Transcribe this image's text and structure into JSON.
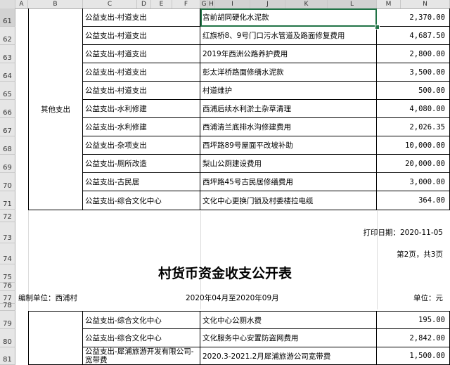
{
  "columns": [
    "A",
    "B",
    "C",
    "D",
    "E",
    "F",
    "G",
    "H",
    "I",
    "J",
    "K",
    "L",
    "M",
    "N"
  ],
  "selected_cell": "G61",
  "rows_top": [
    {
      "row": "61",
      "category": "公益支出-村道支出",
      "desc": "宫前胡同硬化水泥款",
      "amount": "2,370.00"
    },
    {
      "row": "62",
      "category": "公益支出-村道支出",
      "desc": "红旗桥8、9号门口污水管道及路面修复费用",
      "amount": "4,687.50"
    },
    {
      "row": "63",
      "category": "公益支出-村道支出",
      "desc": "2019年西洲公路养护费用",
      "amount": "2,800.00"
    },
    {
      "row": "64",
      "category": "公益支出-村道支出",
      "desc": "彭太洋桥路面修缮水泥款",
      "amount": "3,500.00"
    },
    {
      "row": "65",
      "category": "公益支出-村道支出",
      "desc": "村道维护",
      "amount": "500.00"
    },
    {
      "row": "66",
      "category": "公益支出-水利修建",
      "desc": "西浦后续水利淤土杂草清理",
      "amount": "4,080.00"
    },
    {
      "row": "67",
      "category": "公益支出-水利修建",
      "desc": "西浦清兰底排水沟修建费用",
      "amount": "2,026.35"
    },
    {
      "row": "68",
      "category": "公益支出-杂项支出",
      "desc": "西坪路89号屋面平改坡补助",
      "amount": "10,000.00"
    },
    {
      "row": "69",
      "category": "公益支出-厕所改造",
      "desc": "梨山公厕建设费用",
      "amount": "20,000.00"
    },
    {
      "row": "70",
      "category": "公益支出-古民居",
      "desc": "西坪路45号古民居修缮费用",
      "amount": "3,000.00"
    },
    {
      "row": "71",
      "category": "公益支出-综合文化中心",
      "desc": "文化中心更换门锁及村委楼拉电缆",
      "amount": "364.00"
    }
  ],
  "group_label": "其他支出",
  "print_date": "打印日期：2020-11-05",
  "page_info": "第2页，共3页",
  "title": "村货币资金收支公开表",
  "unit_org": "编制单位：西浦村",
  "period": "2020年04月至2020年09月",
  "unit": "单位：元",
  "rows_bottom": [
    {
      "row": "79",
      "category": "公益支出-综合文化中心",
      "desc": "文化中心公厕水费",
      "amount": "195.00"
    },
    {
      "row": "80",
      "category": "公益支出-综合文化中心",
      "desc": "文化服务中心安置防盗网费用",
      "amount": "2,842.00"
    },
    {
      "row": "81",
      "category": "公益支出-犀浦旅游开发有限公司-宽带费",
      "desc": "2020.3-2021.2月犀浦旅游公司宽带费",
      "amount": "1,500.00"
    }
  ],
  "row_numbers_mid": [
    "72",
    "73",
    "74",
    "75",
    "76",
    "77",
    "78"
  ]
}
